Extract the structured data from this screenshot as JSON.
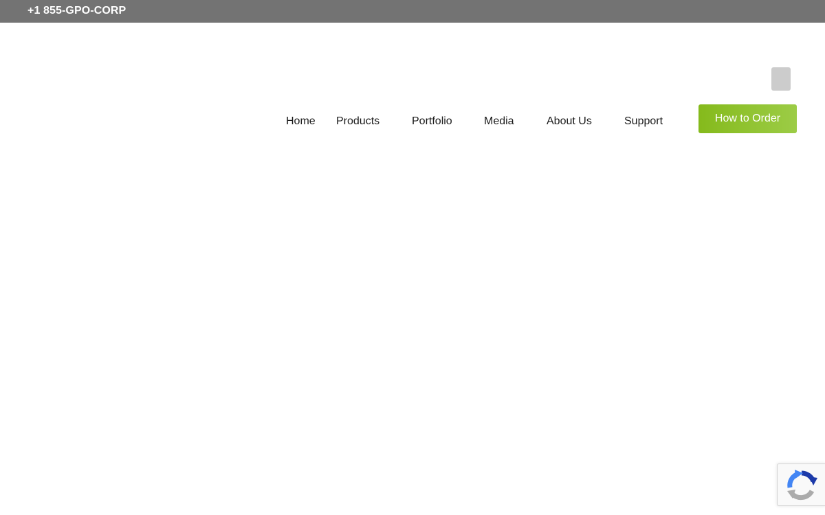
{
  "topbar": {
    "phone": "+1 855-GPO-CORP",
    "background_color": "#737373"
  },
  "header": {
    "search_toggle_icon": "search-toggle-icon"
  },
  "nav": {
    "items": [
      {
        "label": "Home"
      },
      {
        "label": "Products"
      },
      {
        "label": "Portfolio"
      },
      {
        "label": "Media"
      },
      {
        "label": "About Us"
      },
      {
        "label": "Support"
      }
    ],
    "cta": {
      "label": "How to Order",
      "color": "#8dc12a"
    }
  },
  "recaptcha": {
    "icon": "recaptcha-icon"
  }
}
